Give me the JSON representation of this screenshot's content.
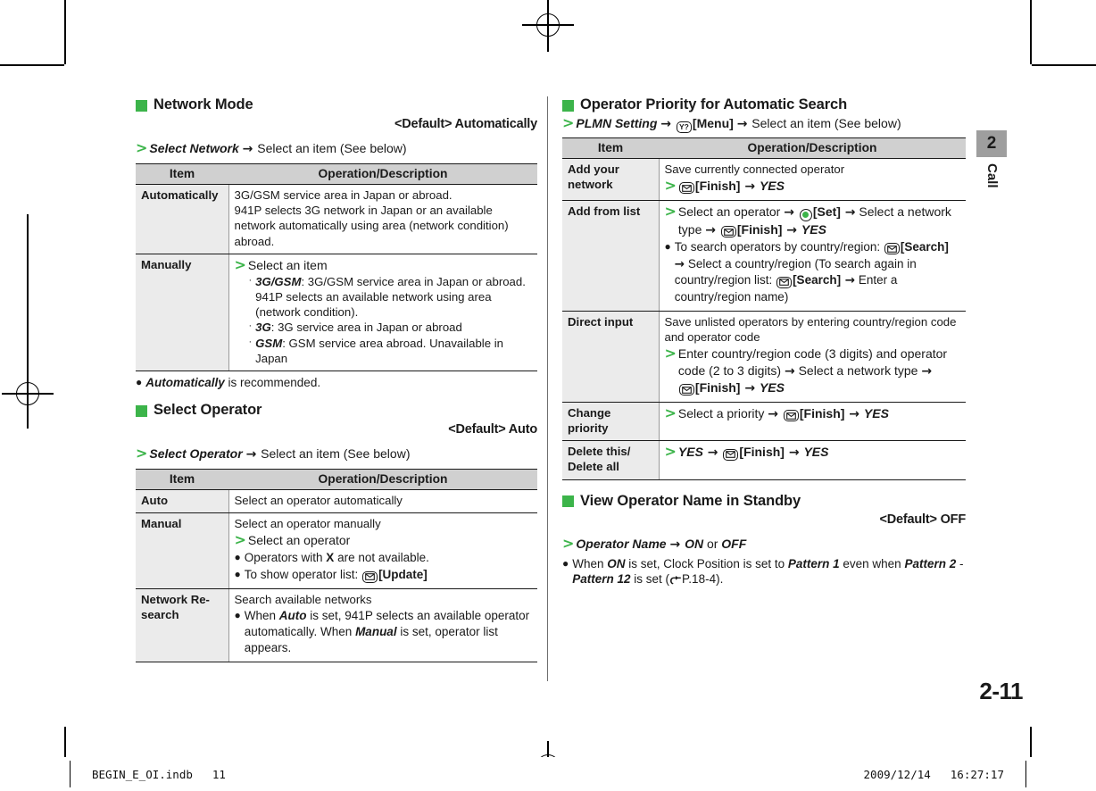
{
  "document": {
    "page_number": "2-11",
    "chapter_number": "2",
    "chapter_label": "Call"
  },
  "footer": {
    "file_name": "BEGIN_E_OI.indb",
    "file_page": "11",
    "date": "2009/12/14",
    "time": "16:27:17"
  },
  "left_column": {
    "network_mode": {
      "heading": "Network Mode",
      "default": "<Default> Automatically",
      "step": {
        "command": "Select Network",
        "arrow": "→",
        "rest": "Select an item (See below)"
      },
      "table": {
        "header_item": "Item",
        "header_desc": "Operation/Description",
        "rows": [
          {
            "item": "Automatically",
            "lines": [
              "3G/GSM service area in Japan or abroad.",
              "941P selects 3G network in Japan or an available network automatically using area (network condition) abroad."
            ]
          },
          {
            "item": "Manually",
            "step": "Select an item",
            "subs": [
              {
                "term": "3G/GSM",
                "text": ": 3G/GSM service area in Japan or abroad. 941P selects an available network using area (network condition)."
              },
              {
                "term": "3G",
                "text": ": 3G service area in Japan or abroad"
              },
              {
                "term": "GSM",
                "text": ": GSM service area abroad. Unavailable in Japan"
              }
            ]
          }
        ]
      },
      "note": {
        "term": "Automatically",
        "text": " is recommended."
      }
    },
    "select_operator": {
      "heading": "Select Operator",
      "default": "<Default> Auto",
      "step": {
        "command": "Select Operator",
        "arrow": "→",
        "rest": "Select an item (See below)"
      },
      "table": {
        "header_item": "Item",
        "header_desc": "Operation/Description",
        "rows": [
          {
            "item": "Auto",
            "desc": "Select an operator automatically"
          },
          {
            "item": "Manual",
            "desc": "Select an operator manually",
            "step": "Select an operator",
            "bullets": [
              {
                "pre": "Operators with ",
                "bold": "X",
                "post": " are not available."
              },
              {
                "pre": "To show operator list: ",
                "icon": "mail-key-icon",
                "bold_bracket": "[Update]"
              }
            ]
          },
          {
            "item": "Network Re-search",
            "desc": "Search available networks",
            "bullets": [
              {
                "text_runs": [
                  "When ",
                  "Auto",
                  " is set, 941P selects an available operator automatically. When ",
                  "Manual",
                  " is set, operator list appears."
                ]
              }
            ]
          }
        ]
      }
    }
  },
  "right_column": {
    "operator_priority": {
      "heading": "Operator Priority for Automatic Search",
      "step": {
        "command": "PLMN Setting",
        "icon": "menu-key-icon",
        "icon_label": "[Menu]",
        "rest": "Select an item (See below)"
      },
      "table": {
        "header_item": "Item",
        "header_desc": "Operation/Description",
        "rows": [
          {
            "item": "Add your network",
            "desc": "Save currently connected operator",
            "step_mail": "[Finish]",
            "step_yes": "YES"
          },
          {
            "item": "Add from list",
            "step_text_1": "Select an operator ",
            "step_set": "[Set]",
            "step_text_2": " Select a network type ",
            "step_finish": "[Finish]",
            "step_yes": "YES",
            "bullet_1": "To search operators by country/region: ",
            "bullet_search_1": "[Search]",
            "bullet_1b": " Select a country/region (To search again in country/region list: ",
            "bullet_search_2": "[Search]",
            "bullet_1c": " Enter a country/region name)"
          },
          {
            "item": "Direct input",
            "desc": "Save unlisted operators by entering country/region code and operator code",
            "step_text": "Enter country/region code (3 digits) and operator code (2 to 3 digits) ",
            "step_text_2": " Select a network type ",
            "step_finish": "[Finish]",
            "step_yes": "YES"
          },
          {
            "item": "Change priority",
            "step_text": "Select a priority ",
            "step_finish": "[Finish]",
            "step_yes": "YES"
          },
          {
            "item": "Delete this/ Delete all",
            "step_yes_1": "YES",
            "step_finish": "[Finish]",
            "step_yes_2": "YES"
          }
        ]
      }
    },
    "view_operator_name": {
      "heading": "View Operator Name in Standby",
      "default": "<Default> OFF",
      "step": {
        "command": "Operator Name",
        "on": "ON",
        "or": " or ",
        "off": "OFF"
      },
      "note": {
        "p1": "When ",
        "on": "ON",
        "p2": " is set, Clock Position is set to ",
        "pattern1": "Pattern 1",
        "p3": " even when ",
        "pattern2": "Pattern 2",
        "dash": " - ",
        "pattern12": "Pattern 12",
        "p4": " is set  (",
        "ref": "P.18-4",
        "p5": ")."
      }
    }
  },
  "colors": {
    "accent_green": "#3cb44a",
    "table_header": "#d0d0d0",
    "item_cell": "#ebebeb",
    "chapter_tab": "#9e9e9e"
  }
}
